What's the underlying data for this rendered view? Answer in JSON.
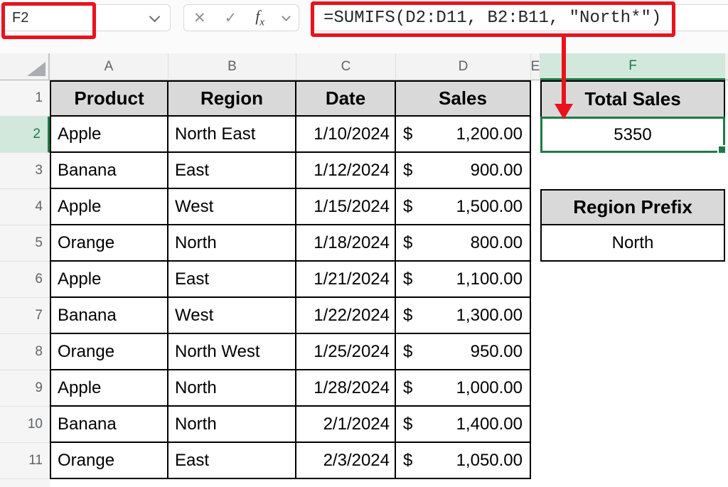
{
  "colors": {
    "annotation_red": "#E8131D",
    "selection_green": "#1E7A44",
    "selected_header_bg": "#D2E8DC",
    "table_header_bg": "#D9D9D9"
  },
  "formula_bar": {
    "name_box_value": "F2",
    "cancel_label": "✕",
    "confirm_label": "✓",
    "fx_f": "f",
    "fx_x": "x",
    "formula": "=SUMIFS(D2:D11, B2:B11, \"North*\")"
  },
  "grid": {
    "column_letters": [
      "A",
      "B",
      "C",
      "D",
      "E",
      "F"
    ],
    "row_numbers": [
      "1",
      "2",
      "3",
      "4",
      "5",
      "6",
      "7",
      "8",
      "9",
      "10",
      "11"
    ],
    "selected_cell": "F2",
    "selected_column": "F",
    "selected_row": "2"
  },
  "table": {
    "headers": [
      "Product",
      "Region",
      "Date",
      "Sales"
    ],
    "currency_symbol": "$",
    "rows": [
      {
        "product": "Apple",
        "region": "North East",
        "date": "1/10/2024",
        "sales": "1,200.00"
      },
      {
        "product": "Banana",
        "region": "East",
        "date": "1/12/2024",
        "sales": "900.00"
      },
      {
        "product": "Apple",
        "region": "West",
        "date": "1/15/2024",
        "sales": "1,500.00"
      },
      {
        "product": "Orange",
        "region": "North",
        "date": "1/18/2024",
        "sales": "800.00"
      },
      {
        "product": "Apple",
        "region": "East",
        "date": "1/21/2024",
        "sales": "1,100.00"
      },
      {
        "product": "Banana",
        "region": "West",
        "date": "1/22/2024",
        "sales": "1,300.00"
      },
      {
        "product": "Orange",
        "region": "North West",
        "date": "1/25/2024",
        "sales": "950.00"
      },
      {
        "product": "Apple",
        "region": "North",
        "date": "1/28/2024",
        "sales": "1,000.00"
      },
      {
        "product": "Banana",
        "region": "North",
        "date": "2/1/2024",
        "sales": "1,400.00"
      },
      {
        "product": "Orange",
        "region": "East",
        "date": "2/3/2024",
        "sales": "1,050.00"
      }
    ]
  },
  "summary": {
    "total_sales_label": "Total Sales",
    "total_sales_value": "5350",
    "region_prefix_label": "Region Prefix",
    "region_prefix_value": "North"
  }
}
